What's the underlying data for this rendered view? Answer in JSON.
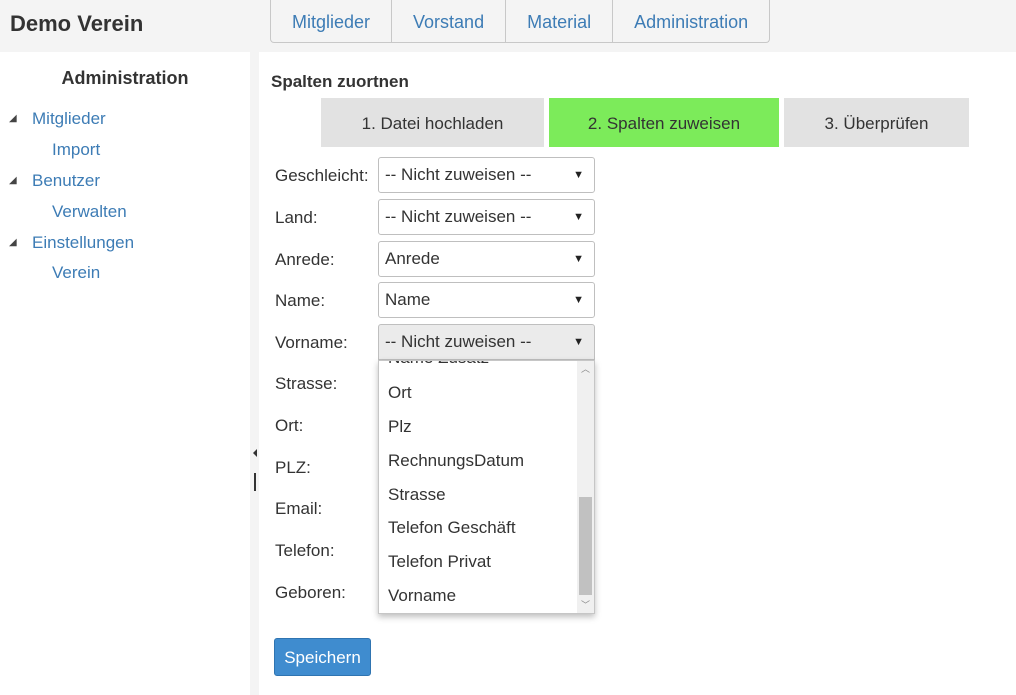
{
  "header": {
    "title": "Demo Verein",
    "nav": [
      "Mitglieder",
      "Vorstand",
      "Material",
      "Administration"
    ]
  },
  "sidebar": {
    "title": "Administration",
    "tree": [
      {
        "label": "Mitglieder",
        "children": [
          "Import"
        ]
      },
      {
        "label": "Benutzer",
        "children": [
          "Verwalten"
        ]
      },
      {
        "label": "Einstellungen",
        "children": [
          "Verein"
        ]
      }
    ],
    "toggle_glyph": "◢"
  },
  "main": {
    "section_title": "Spalten zuortnen",
    "steps": [
      "1. Datei hochladen",
      "2. Spalten zuweisen",
      "3. Überprüfen"
    ],
    "active_step": 1,
    "fields": [
      {
        "label": "Geschleicht:",
        "value": "-- Nicht zuweisen --"
      },
      {
        "label": "Land:",
        "value": "-- Nicht zuweisen --"
      },
      {
        "label": "Anrede:",
        "value": "Anrede"
      },
      {
        "label": "Name:",
        "value": "Name"
      },
      {
        "label": "Vorname:",
        "value": "-- Nicht zuweisen --"
      },
      {
        "label": "Strasse:"
      },
      {
        "label": "Ort:"
      },
      {
        "label": "PLZ:"
      },
      {
        "label": "Email:"
      },
      {
        "label": "Telefon:"
      },
      {
        "label": "Geboren:"
      }
    ],
    "dropdown_options": [
      "Name Zusatz",
      "Ort",
      "Plz",
      "RechnungsDatum",
      "Strasse",
      "Telefon Geschäft",
      "Telefon Privat",
      "Vorname"
    ],
    "save_label": "Speichern"
  },
  "colors": {
    "link": "#3d7cb5",
    "active_step": "#7ceb5a",
    "step": "#e2e2e2",
    "button": "#3f8ccf"
  },
  "icons": {
    "caret": "▼",
    "scroll_up": "︿",
    "scroll_down": "﹀",
    "resize": "◀"
  }
}
